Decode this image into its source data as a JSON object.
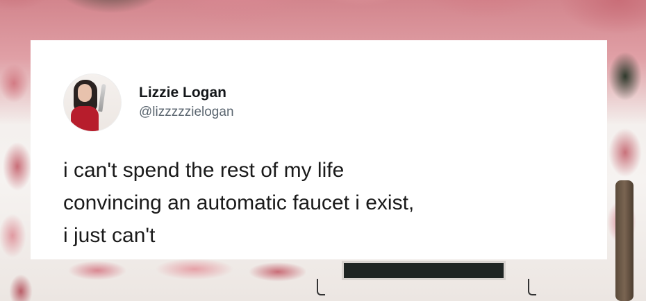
{
  "tweet": {
    "author": {
      "display_name": "Lizzie Logan",
      "handle": "@lizzzzzielogan"
    },
    "text_lines": [
      "i can't spend the rest of my life",
      "convincing an automatic faucet i exist,",
      "i just can't"
    ]
  },
  "colors": {
    "card_background": "#ffffff",
    "text_primary": "#1a1a1a",
    "text_secondary": "#5b6670"
  }
}
